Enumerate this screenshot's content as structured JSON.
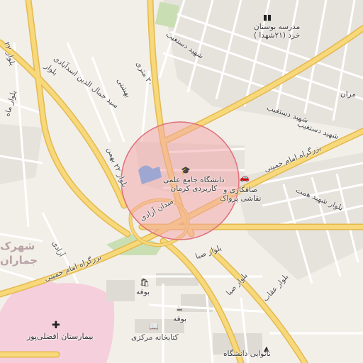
{
  "map": {
    "labels": {
      "school": "مدرسه بوستان خرد (۲۱شهدا )",
      "school_line1": "مدرسه بوستان",
      "school_line2": "خرد (۲۱شهدا )",
      "dastgheib_top": "شهید دستغیب",
      "dastgheib_right": "شهید دستغیب",
      "bahonar": "بهشتی",
      "street20": "۲۰ متری",
      "asadabadi": "بلوار سید جمال الدین اسدآبادی",
      "asad_line1": "سید جمال الدین اسدآبادی",
      "asad_line2": "بلوار",
      "blvd_22bahman": "بلوار ۲۲ بهمن",
      "blvd_left1": "بلوار ۲۲",
      "blvd_left2": "بلوار ماه",
      "university_line1": "دانشگاه جامع علمی",
      "university_line2": "کاربردی کرمان",
      "painting_line1": "صافکاری و",
      "painting_line2": "نقاشی پرواک",
      "imam_khomeini_right": "بزرگراه امام خمینی",
      "imam_khomeini_left": "بزرگراه امام خمینی",
      "shahid_hemmat": "بلوار شهید همت",
      "square": "میدان آزادی",
      "azadi": "آزادی",
      "saba1": "بلوار صبا",
      "saba2": "بلوار صبا",
      "oghab": "بلوار عقاب",
      "bufe1": "بوفه",
      "bufe2": "بوفه",
      "library": "کتابخانه مرکزی",
      "bakery": "نانوایی دانشگاه",
      "hospital": "بیمارستان افضلی‌پور",
      "district_line1": "شهرک",
      "district_line2": "جماران",
      "jamaran_right": "مران",
      "shahid_dastgheib_alt": "شهید دستغیب"
    },
    "icons": {
      "school": "school-icon",
      "university": "graduation-cap-icon",
      "car": "car-repair-icon",
      "cafe1": "shopping-bag-icon",
      "cafe2": "coffee-icon",
      "library": "book-icon",
      "bakery": "bakery-icon",
      "hospital": "hospital-cross-icon"
    },
    "colors": {
      "land": "#f2efe9",
      "block": "#e4e0db",
      "minor_road": "#ffffff",
      "major_road": "#f7d87a",
      "major_road_edge": "#e4b94f",
      "green": "#c9dfb3",
      "hospital": "#f6cfdc",
      "circle_fill": "#f4a3a8",
      "circle_stroke": "#e0707a"
    },
    "highlight": {
      "shape": "circle",
      "label": ""
    }
  }
}
